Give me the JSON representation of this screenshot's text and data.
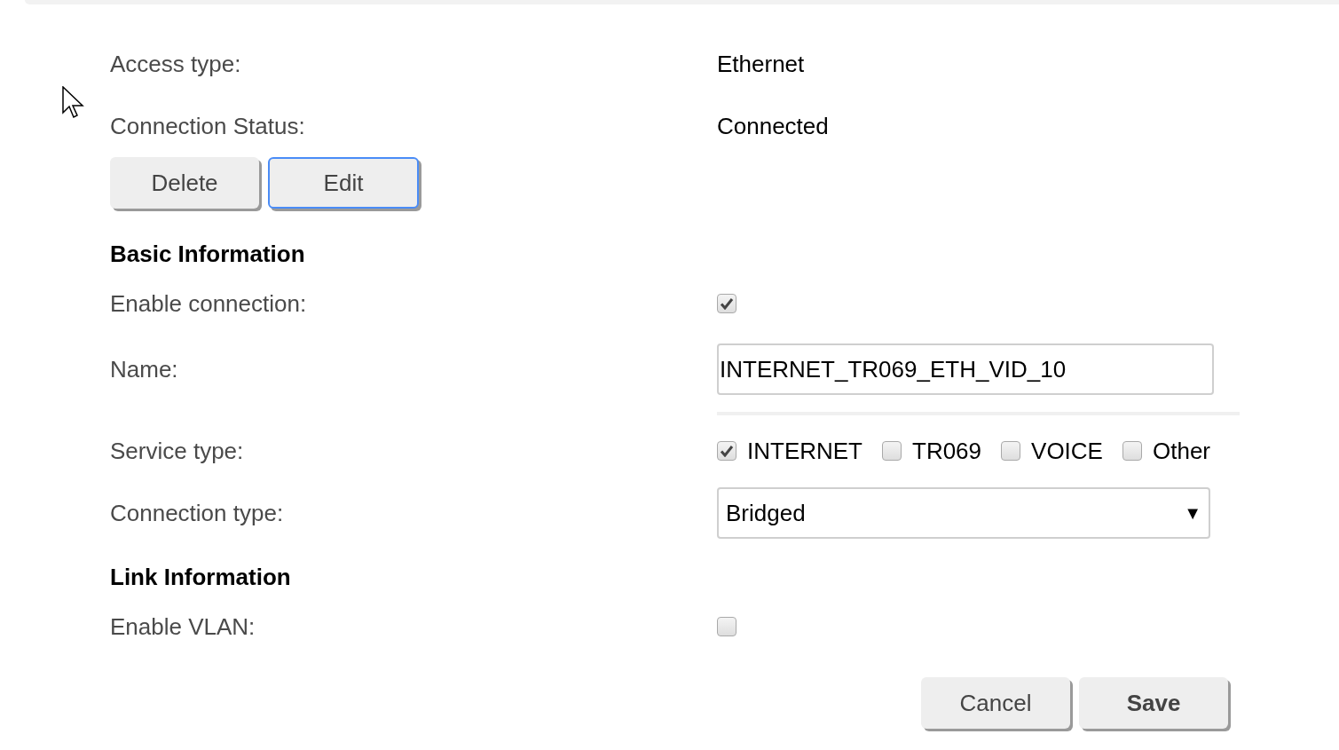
{
  "header_rows": [
    {
      "label": "Access type:",
      "value": "Ethernet"
    },
    {
      "label": "Connection Status:",
      "value": "Connected"
    }
  ],
  "actions": [
    {
      "label": "Delete",
      "focused": false
    },
    {
      "label": "Edit",
      "focused": true
    }
  ],
  "sections": [
    {
      "title": "Basic Information",
      "fields": [
        {
          "kind": "checkbox",
          "label": "Enable connection:",
          "checked": true
        },
        {
          "kind": "text",
          "label": "Name:",
          "value": "INTERNET_TR069_ETH_VID_10"
        },
        {
          "kind": "checkgroup",
          "label": "Service type:",
          "options": [
            {
              "label": "INTERNET",
              "checked": true
            },
            {
              "label": "TR069",
              "checked": false
            },
            {
              "label": "VOICE",
              "checked": false
            },
            {
              "label": "Other",
              "checked": false
            }
          ]
        },
        {
          "kind": "select",
          "label": "Connection type:",
          "value": "Bridged",
          "arrow": "▼"
        }
      ]
    },
    {
      "title": "Link Information",
      "fields": [
        {
          "kind": "checkbox",
          "label": "Enable VLAN:",
          "checked": false
        }
      ]
    }
  ],
  "footer_buttons": [
    {
      "label": "Cancel",
      "primary": false
    },
    {
      "label": "Save",
      "primary": true
    }
  ]
}
